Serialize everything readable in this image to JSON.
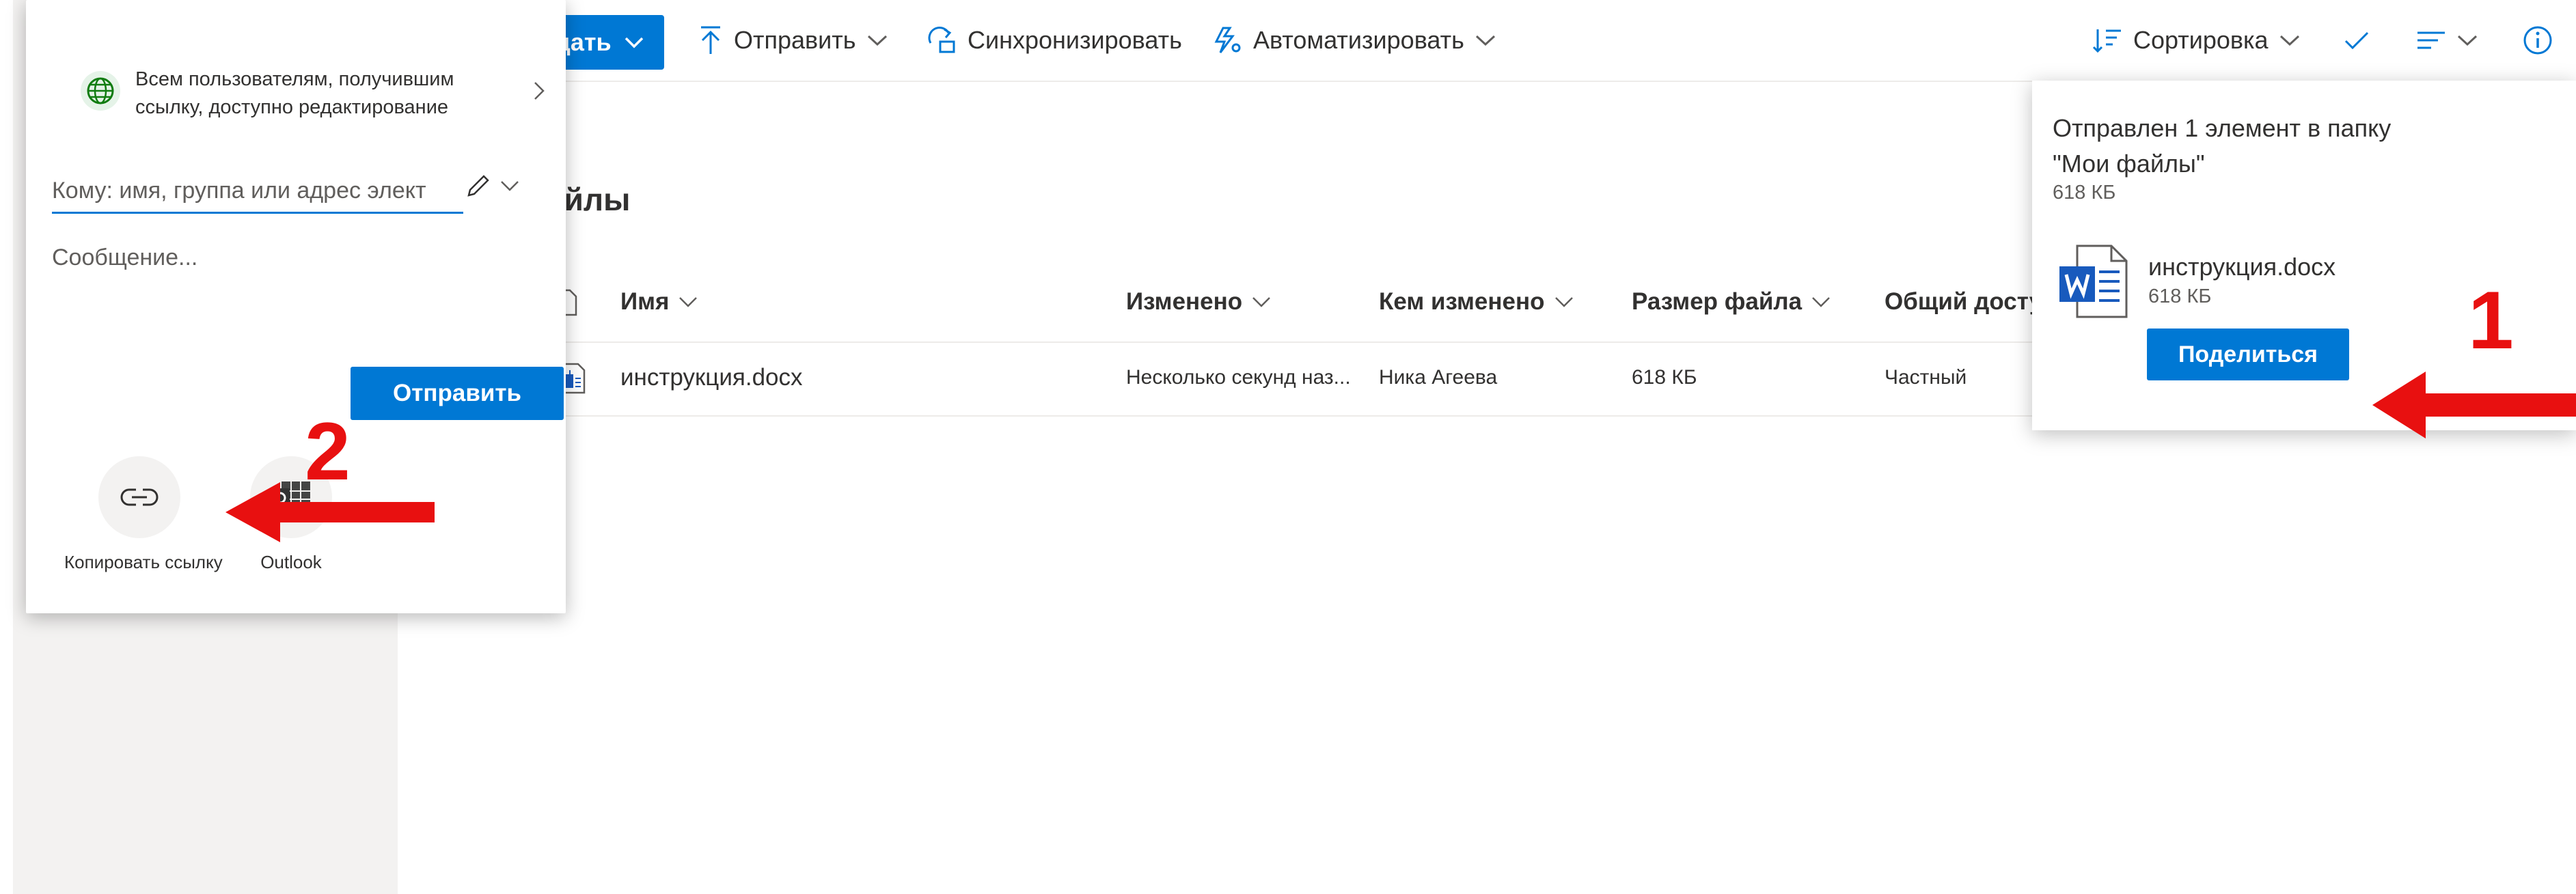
{
  "toolbar": {
    "create_label": "дать",
    "upload_label": "Отправить",
    "sync_label": "Синхронизировать",
    "automate_label": "Автоматизировать",
    "sort_label": "Сортировка"
  },
  "page": {
    "title": "айлы"
  },
  "table": {
    "columns": [
      "Имя",
      "Изменено",
      "Кем изменено",
      "Размер файла",
      "Общий досту"
    ],
    "rows": [
      {
        "name": "инструкция.docx",
        "modified": "Несколько секунд наз...",
        "modified_by": "Ника Агеева",
        "size": "618 КБ",
        "sharing": "Частный"
      }
    ]
  },
  "share_panel": {
    "permission_text": "Всем пользователям, получившим ссылку, доступно редактирование",
    "to_placeholder": "Кому: имя, группа или адрес элект",
    "message_placeholder": "Сообщение...",
    "send_label": "Отправить",
    "options": [
      {
        "label": "Копировать ссылку",
        "icon": "link-icon"
      },
      {
        "label": "Outlook",
        "icon": "outlook-icon"
      }
    ]
  },
  "toast": {
    "message": "Отправлен 1 элемент в папку \"Мои файлы\"",
    "size": "618 КБ",
    "file_name": "инструкция.docx",
    "file_size": "618 КБ",
    "share_label": "Поделиться"
  },
  "annotations": {
    "num_1": "1",
    "num_2": "2"
  },
  "colors": {
    "accent": "#0078d4",
    "annotation": "#e81010",
    "word_blue": "#185abd"
  }
}
